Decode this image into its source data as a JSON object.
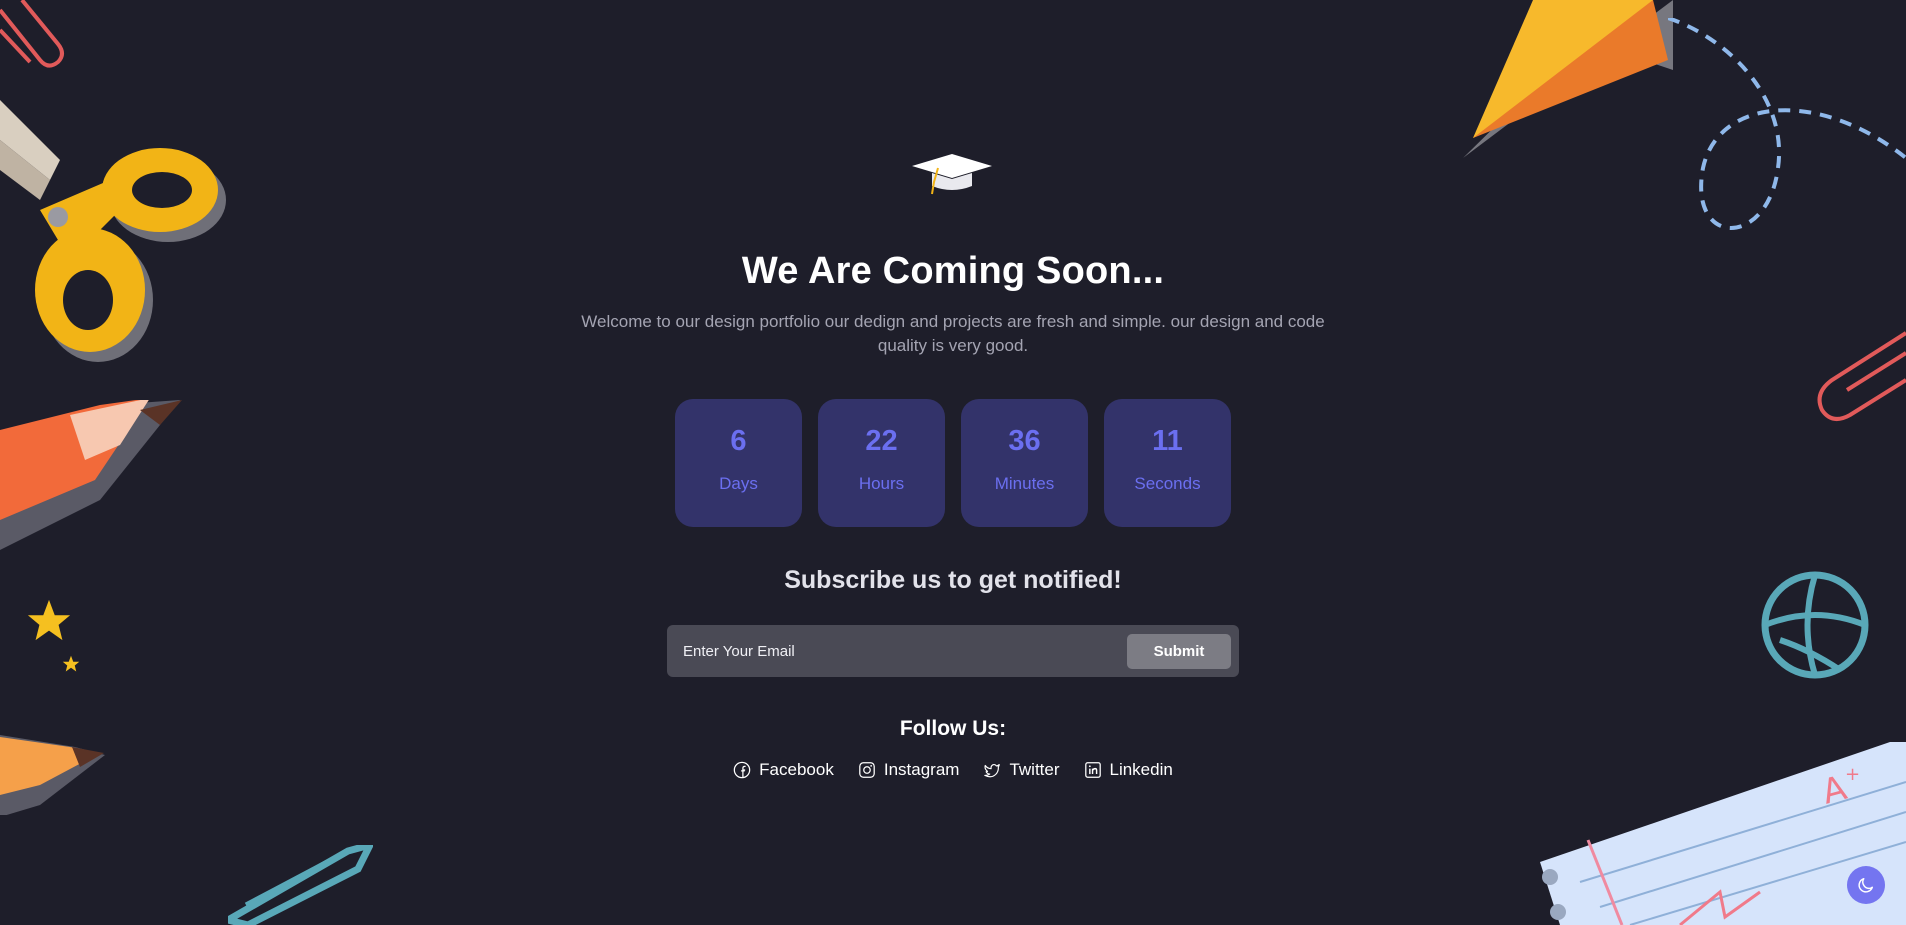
{
  "header": {
    "logo_icon": "graduation-cap-icon",
    "title": "We Are Coming Soon...",
    "description": "Welcome to our design portfolio our dedign and projects are fresh and simple. our design and code quality is very good."
  },
  "countdown": [
    {
      "value": "6",
      "label": "Days"
    },
    {
      "value": "22",
      "label": "Hours"
    },
    {
      "value": "36",
      "label": "Minutes"
    },
    {
      "value": "11",
      "label": "Seconds"
    }
  ],
  "subscribe": {
    "title": "Subscribe us to get notified!",
    "email_placeholder": "Enter Your Email",
    "submit_label": "Submit"
  },
  "follow": {
    "title": "Follow Us:",
    "links": [
      {
        "label": "Facebook",
        "icon": "facebook-icon"
      },
      {
        "label": "Instagram",
        "icon": "instagram-icon"
      },
      {
        "label": "Twitter",
        "icon": "twitter-icon"
      },
      {
        "label": "Linkedin",
        "icon": "linkedin-icon"
      }
    ]
  },
  "theme_toggle": {
    "icon": "moon-icon"
  },
  "colors": {
    "background": "#1e1e2a",
    "accent": "#6b6ff0",
    "countdown_box": "#33336a",
    "toggle": "#7475f0"
  }
}
